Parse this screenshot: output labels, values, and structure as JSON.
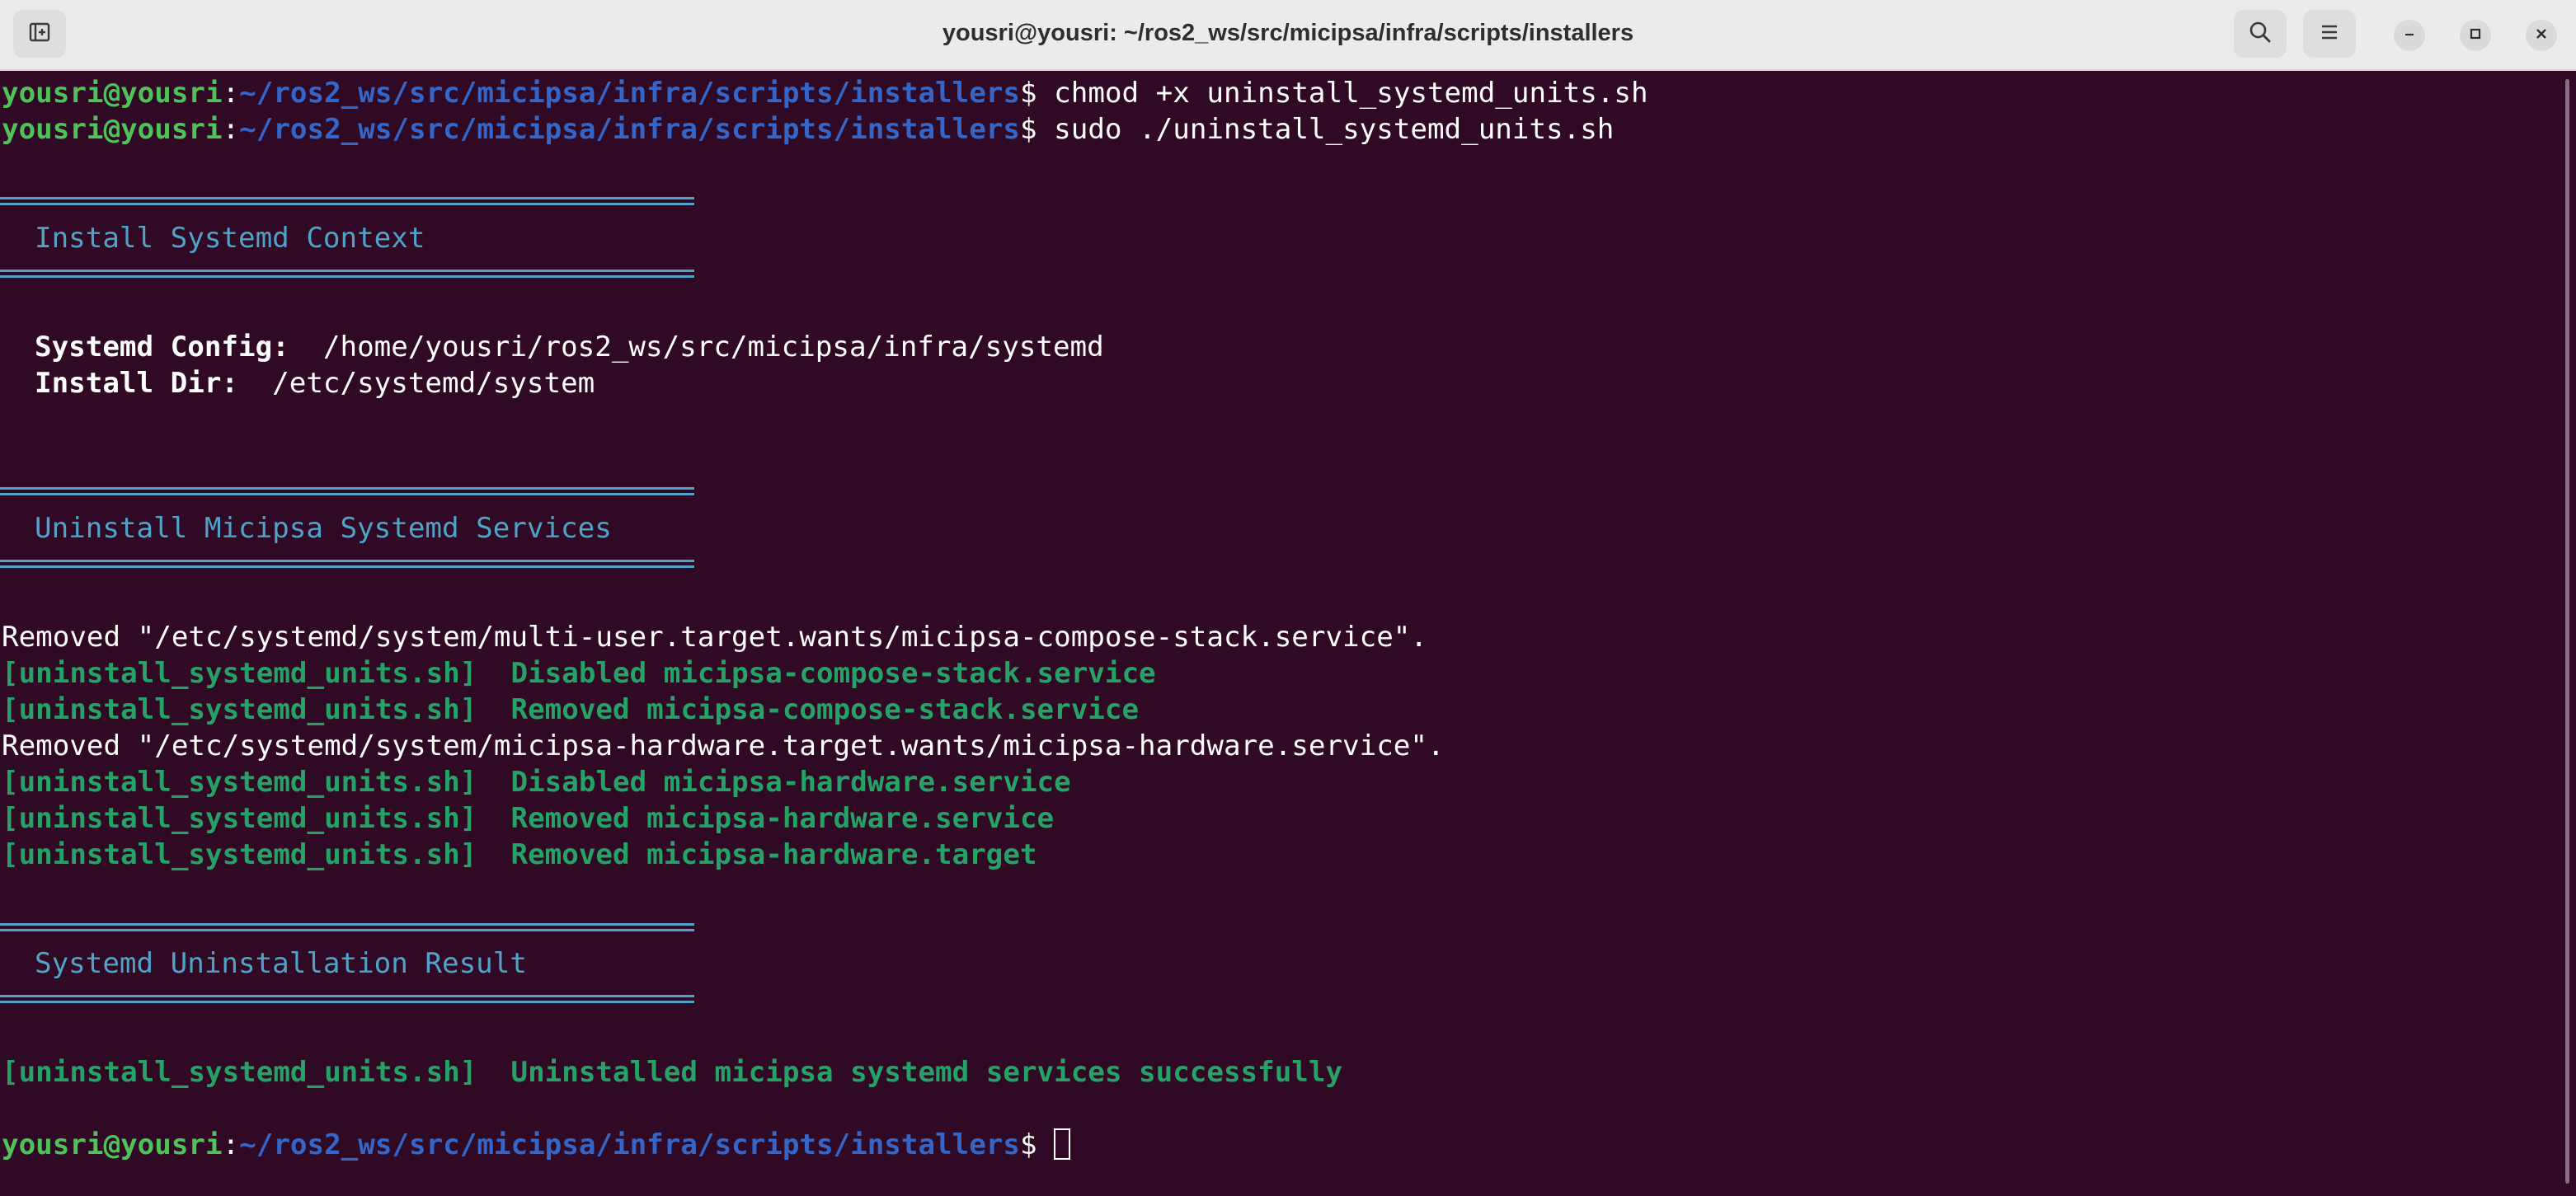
{
  "window": {
    "title": "yousri@yousri: ~/ros2_ws/src/micipsa/infra/scripts/installers"
  },
  "header": {
    "new_tab_icon": "new-tab-icon",
    "search_icon": "search-icon",
    "menu_icon": "hamburger-menu-icon",
    "minimize_icon": "minimize-icon",
    "maximize_icon": "maximize-icon",
    "close_icon": "close-icon"
  },
  "prompt": {
    "user_host": "yousri@yousri",
    "colon": ":",
    "path": "~/ros2_ws/src/micipsa/infra/scripts/installers",
    "dollar": "$"
  },
  "commands": [
    " chmod +x uninstall_systemd_units.sh",
    " sudo ./uninstall_systemd_units.sh"
  ],
  "sections": {
    "context_title": "Install Systemd Context",
    "uninstall_title": "Uninstall Micipsa Systemd Services",
    "result_title": "Systemd Uninstallation Result"
  },
  "context": {
    "config_label": "Systemd Config:",
    "config_value": "  /home/yousri/ros2_ws/src/micipsa/infra/systemd",
    "install_label": "Install Dir:",
    "install_value": "  /etc/systemd/system"
  },
  "output": {
    "removed_compose": "Removed \"/etc/systemd/system/multi-user.target.wants/micipsa-compose-stack.service\".",
    "tag": "[uninstall_systemd_units.sh]",
    "disabled_compose": "  Disabled micipsa-compose-stack.service",
    "removed_compose_svc": "  Removed micipsa-compose-stack.service",
    "removed_hardware": "Removed \"/etc/systemd/system/micipsa-hardware.target.wants/micipsa-hardware.service\".",
    "disabled_hardware": "  Disabled micipsa-hardware.service",
    "removed_hardware_svc": "  Removed micipsa-hardware.service",
    "removed_hardware_target": "  Removed micipsa-hardware.target",
    "success": "  Uninstalled micipsa systemd services successfully"
  },
  "colors": {
    "background": "#300a24",
    "prompt_user": "#4ec24a",
    "prompt_path": "#3466c9",
    "section": "#4fa3c7",
    "log_green": "#26a269",
    "header_bg": "#ebebeb"
  }
}
